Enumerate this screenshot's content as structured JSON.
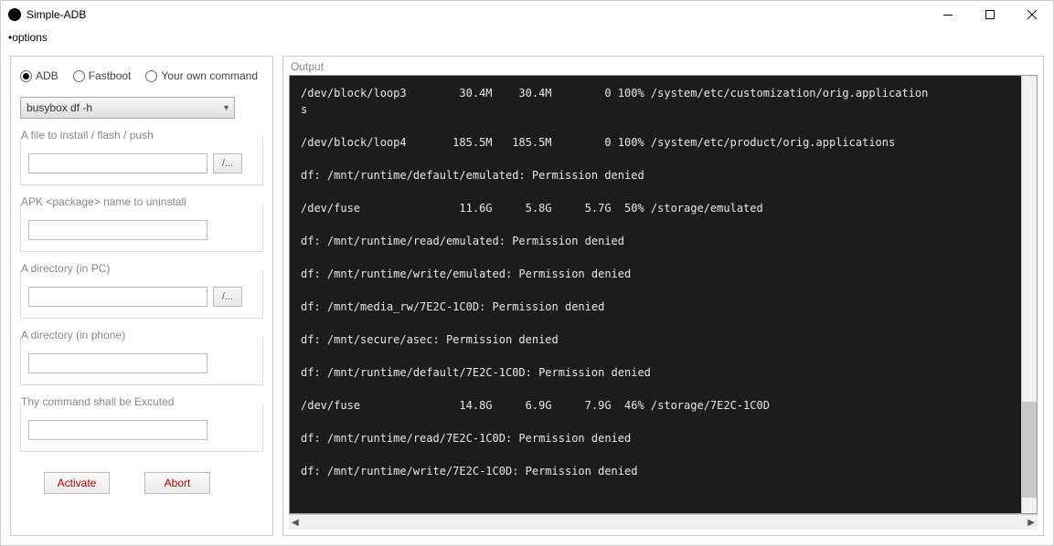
{
  "window": {
    "title": "Simple-ADB"
  },
  "menu": {
    "options": "options"
  },
  "modes": {
    "adb": "ADB",
    "fastboot": "Fastboot",
    "own": "Your own command"
  },
  "dropdown": {
    "selected": "busybox df -h"
  },
  "groups": {
    "install": {
      "label": "A file to install / flash / push",
      "browse": "/..."
    },
    "uninstall": {
      "label": "APK <package> name to uninstall"
    },
    "dir_pc": {
      "label": "A directory (in PC)",
      "browse": "/..."
    },
    "dir_phone": {
      "label": "A directory (in phone)"
    },
    "cmd": {
      "label": "Thy command shall be Excuted"
    }
  },
  "buttons": {
    "activate": "Activate",
    "abort": "Abort"
  },
  "output": {
    "label": "Output"
  },
  "console_lines": [
    "/dev/block/loop3        30.4M    30.4M        0 100% /system/etc/customization/orig.application\ns",
    "/dev/block/loop4       185.5M   185.5M        0 100% /system/etc/product/orig.applications",
    "df: /mnt/runtime/default/emulated: Permission denied",
    "/dev/fuse               11.6G     5.8G     5.7G  50% /storage/emulated",
    "df: /mnt/runtime/read/emulated: Permission denied",
    "df: /mnt/runtime/write/emulated: Permission denied",
    "df: /mnt/media_rw/7E2C-1C0D: Permission denied",
    "df: /mnt/secure/asec: Permission denied",
    "df: /mnt/runtime/default/7E2C-1C0D: Permission denied",
    "/dev/fuse               14.8G     6.9G     7.9G  46% /storage/7E2C-1C0D",
    "df: /mnt/runtime/read/7E2C-1C0D: Permission denied",
    "df: /mnt/runtime/write/7E2C-1C0D: Permission denied"
  ]
}
